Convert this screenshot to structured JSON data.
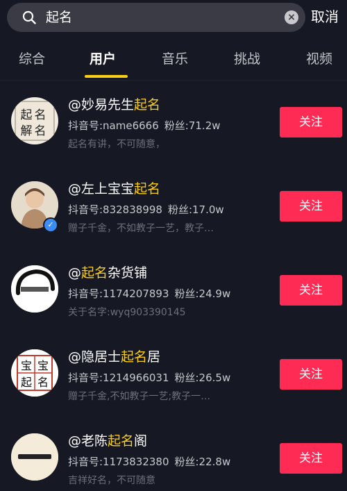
{
  "search": {
    "query": "起名",
    "clear_glyph": "×",
    "cancel_label": "取消"
  },
  "tabs": [
    {
      "label": "综合"
    },
    {
      "label": "用户",
      "active": true
    },
    {
      "label": "音乐"
    },
    {
      "label": "挑战"
    },
    {
      "label": "视频"
    }
  ],
  "results": [
    {
      "name_prefix": "@妙易先生",
      "name_highlight": "起名",
      "name_suffix": "",
      "id_label": "抖音号:name6666",
      "fans_label": "粉丝:71.2w",
      "bio": "起名有讲，不可随意，",
      "follow_label": "关注",
      "avatar_chars": [
        "名",
        "起",
        "名",
        "解"
      ],
      "verified": false
    },
    {
      "name_prefix": "@左上宝宝",
      "name_highlight": "起名",
      "name_suffix": "",
      "id_label": "抖音号:832838998",
      "fans_label": "粉丝:17.0w",
      "bio": "赠子千金，不如教子一艺，教子…",
      "follow_label": "关注",
      "verified": true
    },
    {
      "name_prefix": "@",
      "name_highlight": "起名",
      "name_suffix": "杂货铺",
      "id_label": "抖音号:1174207893",
      "fans_label": "粉丝:24.9w",
      "bio": "关于名字:wyq903390145",
      "follow_label": "关注",
      "verified": false
    },
    {
      "name_prefix": "@隐居士",
      "name_highlight": "起名",
      "name_suffix": "居",
      "id_label": "抖音号:1214966031",
      "fans_label": "粉丝:26.5w",
      "bio": "赠子千金,不如教子一艺;教子一…",
      "follow_label": "关注",
      "avatar_chars": [
        "宝",
        "宝",
        "起",
        "名"
      ],
      "verified": false
    },
    {
      "name_prefix": "@老陈",
      "name_highlight": "起名",
      "name_suffix": "阁",
      "id_label": "抖音号:1173832380",
      "fans_label": "粉丝:22.8w",
      "bio": "吉祥好名，不可随意",
      "follow_label": "关注",
      "verified": false
    }
  ],
  "colors": {
    "background": "#161823",
    "accent_yellow": "#face15",
    "follow_red": "#fe2c55",
    "verified_blue": "#3b8cf5"
  }
}
